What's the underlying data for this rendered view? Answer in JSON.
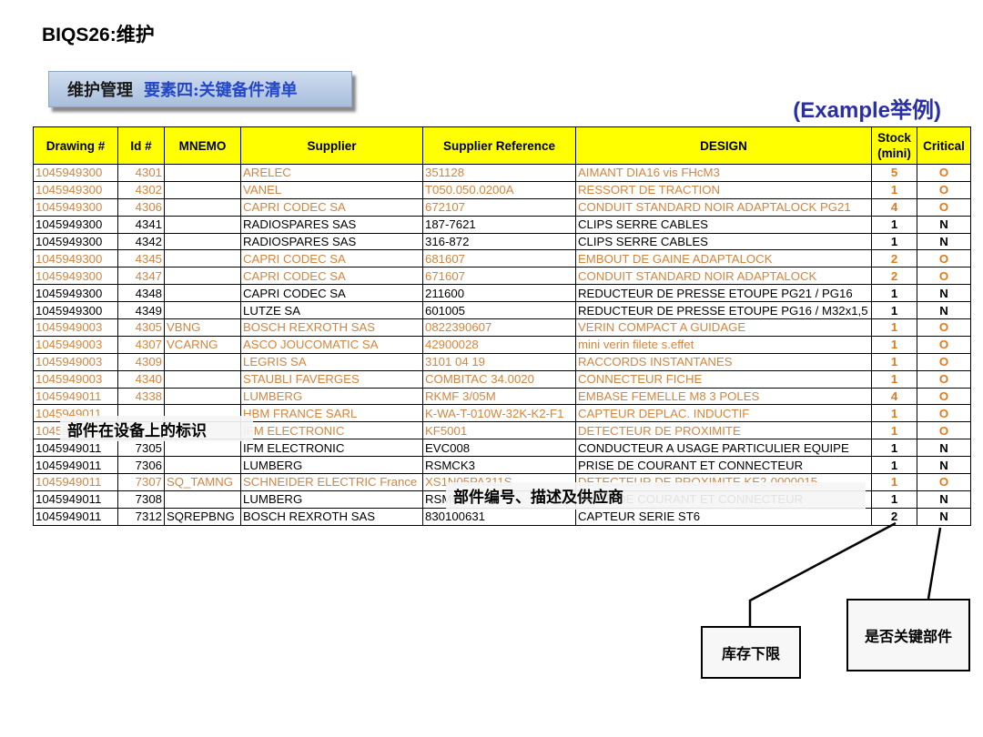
{
  "page_title": "BIQS26:维护",
  "section_box": {
    "main": "维护管理",
    "sub": "要素四:关键备件清单"
  },
  "example_label": "(Example举例)",
  "headers": [
    "Drawing #",
    "Id #",
    "MNEMO",
    "Supplier",
    "Supplier Reference",
    "DESIGN",
    "Stock (mini)",
    "Critical"
  ],
  "rows": [
    {
      "style": "orange",
      "drawing": "1045949300",
      "id": "4301",
      "mnemo": "",
      "supplier": "ARELEC",
      "ref": "351128",
      "design": "AIMANT DIA16 vis FHcM3",
      "stock": "5",
      "critical": "O"
    },
    {
      "style": "orange",
      "drawing": "1045949300",
      "id": "4302",
      "mnemo": "",
      "supplier": "VANEL",
      "ref": "T050.050.0200A",
      "design": "RESSORT DE TRACTION",
      "stock": "1",
      "critical": "O"
    },
    {
      "style": "orange",
      "drawing": "1045949300",
      "id": "4306",
      "mnemo": "",
      "supplier": "CAPRI CODEC SA",
      "ref": "672107",
      "design": "CONDUIT STANDARD NOIR ADAPTALOCK PG21",
      "stock": "4",
      "critical": "O"
    },
    {
      "style": "black",
      "drawing": "1045949300",
      "id": "4341",
      "mnemo": "",
      "supplier": "RADIOSPARES SAS",
      "ref": "187-7621",
      "design": "CLIPS SERRE CABLES",
      "stock": "1",
      "critical": "N"
    },
    {
      "style": "black",
      "drawing": "1045949300",
      "id": "4342",
      "mnemo": "",
      "supplier": "RADIOSPARES SAS",
      "ref": "316-872",
      "design": "CLIPS SERRE CABLES",
      "stock": "1",
      "critical": "N"
    },
    {
      "style": "orange",
      "drawing": "1045949300",
      "id": "4345",
      "mnemo": "",
      "supplier": "CAPRI CODEC SA",
      "ref": "681607",
      "design": "EMBOUT DE GAINE ADAPTALOCK",
      "stock": "2",
      "critical": "O"
    },
    {
      "style": "orange",
      "drawing": "1045949300",
      "id": "4347",
      "mnemo": "",
      "supplier": "CAPRI CODEC SA",
      "ref": "671607",
      "design": "CONDUIT STANDARD NOIR ADAPTALOCK",
      "stock": "2",
      "critical": "O"
    },
    {
      "style": "black",
      "drawing": "1045949300",
      "id": "4348",
      "mnemo": "",
      "supplier": "CAPRI CODEC SA",
      "ref": "211600",
      "design": "REDUCTEUR DE PRESSE ETOUPE PG21 / PG16",
      "stock": "1",
      "critical": "N"
    },
    {
      "style": "black",
      "drawing": "1045949300",
      "id": "4349",
      "mnemo": "",
      "supplier": "LUTZE SA",
      "ref": "601005",
      "design": "REDUCTEUR DE PRESSE ETOUPE PG16 / M32x1,5",
      "stock": "1",
      "critical": "N"
    },
    {
      "style": "orange",
      "drawing": "1045949003",
      "id": "4305",
      "mnemo": "VBNG",
      "supplier": "BOSCH REXROTH SAS",
      "ref": "0822390607",
      "design": "VERIN COMPACT A GUIDAGE",
      "stock": "1",
      "critical": "O"
    },
    {
      "style": "orange",
      "drawing": "1045949003",
      "id": "4307",
      "mnemo": "VCARNG",
      "supplier": "ASCO JOUCOMATIC SA",
      "ref": "42900028",
      "design": "mini verin filete s.effet",
      "stock": "1",
      "critical": "O"
    },
    {
      "style": "orange",
      "drawing": "1045949003",
      "id": "4309",
      "mnemo": "",
      "supplier": "LEGRIS SA",
      "ref": "3101 04 19",
      "design": "RACCORDS INSTANTANES",
      "stock": "1",
      "critical": "O"
    },
    {
      "style": "orange",
      "drawing": "1045949003",
      "id": "4340",
      "mnemo": "",
      "supplier": "STAUBLI FAVERGES",
      "ref": "COMBITAC 34.0020",
      "design": "CONNECTEUR FICHE",
      "stock": "1",
      "critical": "O"
    },
    {
      "style": "orange",
      "drawing": "1045949011",
      "id": "4338",
      "mnemo": "",
      "supplier": "LUMBERG",
      "ref": "RKMF 3/05M",
      "design": "EMBASE FEMELLE M8 3 POLES",
      "stock": "4",
      "critical": "O"
    },
    {
      "style": "orange",
      "drawing": "1045949011",
      "id": "",
      "mnemo": "",
      "supplier": "HBM FRANCE SARL",
      "ref": "K-WA-T-010W-32K-K2-F1",
      "design": "CAPTEUR DEPLAC. INDUCTIF",
      "stock": "1",
      "critical": "O"
    },
    {
      "style": "orange",
      "drawing": "1045949011",
      "id": "",
      "mnemo": "",
      "supplier": "IFM ELECTRONIC",
      "ref": "KF5001",
      "design": "DETECTEUR DE PROXIMITE",
      "stock": "1",
      "critical": "O"
    },
    {
      "style": "black",
      "drawing": "1045949011",
      "id": "7305",
      "mnemo": "",
      "supplier": "IFM ELECTRONIC",
      "ref": "EVC008",
      "design": "CONDUCTEUR A USAGE PARTICULIER EQUIPE",
      "stock": "1",
      "critical": "N"
    },
    {
      "style": "black",
      "drawing": "1045949011",
      "id": "7306",
      "mnemo": "",
      "supplier": "LUMBERG",
      "ref": "RSMCK3",
      "design": "PRISE DE COURANT ET CONNECTEUR",
      "stock": "1",
      "critical": "N"
    },
    {
      "style": "orange",
      "drawing": "1045949011",
      "id": "7307",
      "mnemo": "SQ_TAMNG",
      "supplier": "SCHNEIDER ELECTRIC France",
      "ref": "XS1N05PA311S",
      "design": "DETECTEUR DE PROXIMITE KE2-0000015",
      "stock": "1",
      "critical": "O"
    },
    {
      "style": "black",
      "drawing": "1045949011",
      "id": "7308",
      "mnemo": "",
      "supplier": "LUMBERG",
      "ref": "RSMCK3",
      "design": "PRISE DE COURANT ET CONNECTEUR",
      "stock": "1",
      "critical": "N"
    },
    {
      "style": "black",
      "drawing": "1045949011",
      "id": "7312",
      "mnemo": "SQREPBNG",
      "supplier": "BOSCH REXROTH SAS",
      "ref": "830100631",
      "design": "CAPTEUR SERIE ST6",
      "stock": "2",
      "critical": "N"
    }
  ],
  "annotations": {
    "part_marking": "部件在设备上的标识",
    "part_info": "部件编号、描述及供应商"
  },
  "callouts": {
    "stock_min": "库存下限",
    "critical_part": "是否关键部件"
  }
}
